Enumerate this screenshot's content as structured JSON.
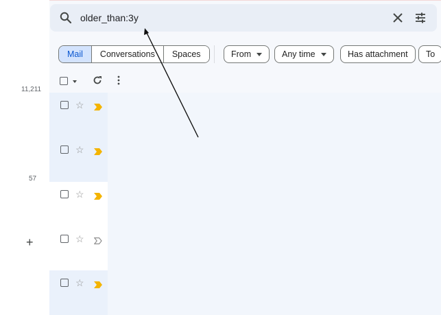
{
  "search": {
    "query": "older_than:3y"
  },
  "left_counts": {
    "inbox": "11,211",
    "other": "57"
  },
  "filters": {
    "segments": [
      "Mail",
      "Conversations",
      "Spaces"
    ],
    "chips": [
      {
        "label": "From",
        "dropdown": true
      },
      {
        "label": "Any time",
        "dropdown": true
      },
      {
        "label": "Has attachment",
        "dropdown": false
      },
      {
        "label": "To",
        "dropdown": false
      }
    ]
  },
  "icons": {
    "search": "search-icon",
    "clear": "close-icon",
    "tune": "tune-icon",
    "refresh": "refresh-icon",
    "more": "more-vert-icon",
    "star": "star-icon",
    "important": "important-marker-icon",
    "compose": "plus-icon"
  },
  "colors": {
    "accent": "#0b57d0",
    "important": "#f4b400",
    "search_bg": "#e9eef6"
  }
}
